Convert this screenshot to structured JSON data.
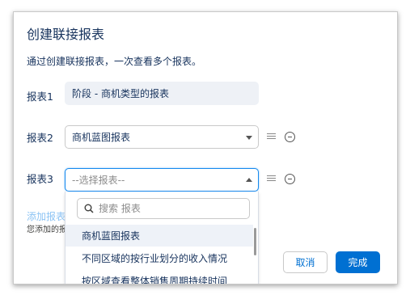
{
  "dialog": {
    "title": "创建联接报表",
    "description": "通过创建联接报表，一次查看多个报表。"
  },
  "rows": [
    {
      "label": "报表1",
      "value": "阶段 - 商机类型的报表"
    },
    {
      "label": "报表2",
      "value": "商机蓝图报表"
    },
    {
      "label": "报表3",
      "placeholder": "--选择报表--"
    }
  ],
  "add_link": "添加报表",
  "note": "您添加的报",
  "dropdown": {
    "search_placeholder": "搜索 报表",
    "options": [
      "商机蓝图报表",
      "不同区域的按行业划分的收入情况",
      "按区域查看整体销售周期持续时间"
    ]
  },
  "buttons": {
    "cancel": "取消",
    "done": "完成"
  },
  "colors": {
    "brand": "#0070d2",
    "focus": "#1589ee",
    "text": "#16325c"
  }
}
